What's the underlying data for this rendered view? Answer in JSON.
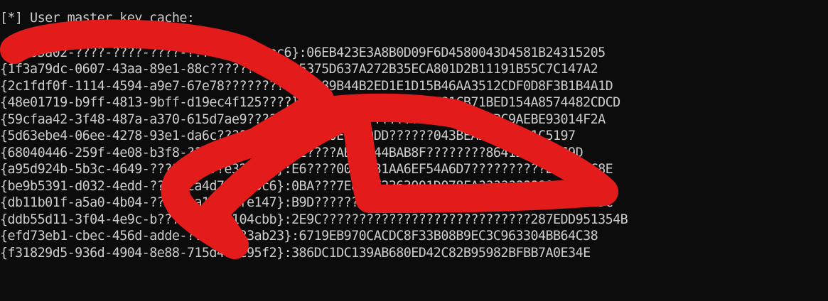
{
  "terminal": {
    "header": "[*] User master key cache:",
    "lines": [
      "{9bb35a02-????-????-????-????????555ec6}:06EB423E3A8B0D09F6D4580043D4581B24315205",
      "{1f3a79dc-0607-43aa-89e1-88c???????407}:5375D637A272B35ECA801D2B11191B55C7C147A2",
      "{2c1fdf0f-1114-4594-a9e7-67e78??????????}:689B44B2ED1E1D15B46AA3512CDF0D8F3B1B4A1D",
      "{48e01719-b9ff-4813-9bff-d19ec4f125????}:????????????AE78CF81CB71BED154A8574482CDCD",
      "{59cfaa42-3f48-487a-a370-615d7ae9??????}:????????????????CD41DBEF1BC9AEBE93014F2A",
      "{5d63ebe4-06ee-4278-93e1-da6c????????2}:????0E5EB0DD??????043BEABA83FB31C5197",
      "{68040446-259f-4e08-b3f8-????????430f7}:E????AB36144BAB8F????????8641DAAF9AC9D",
      "{a95d924b-5b3c-4649-??????????e32756e}:E6????007F531AA6EF54A6D7??????????E0933FC8E",
      "{be9b5391-d032-4edd-????-ca4d750a95c6}:0BA???7E8C2F2363001D078FA??????????1F69FD9",
      "{db11b01f-a5a0-4b04-????-ba1c161fe147}:B9D???????A26DBB128C????????????????7F521DC",
      "{ddb55d11-3f04-4e9c-b???-??8639104cbb}:2E9C????????????????????????????287EDD951354B",
      "{efd73eb1-cbec-456d-adde-??????523ab23}:6719EB970CACDC8F33B08B9EC3C963304BB64C38",
      "{f31829d5-936d-4904-8e88-715d474e95f2}:386DC1DC139AB680ED42C82B95982BFBB7A0E34E"
    ],
    "redaction_color": "#e31b1b"
  }
}
